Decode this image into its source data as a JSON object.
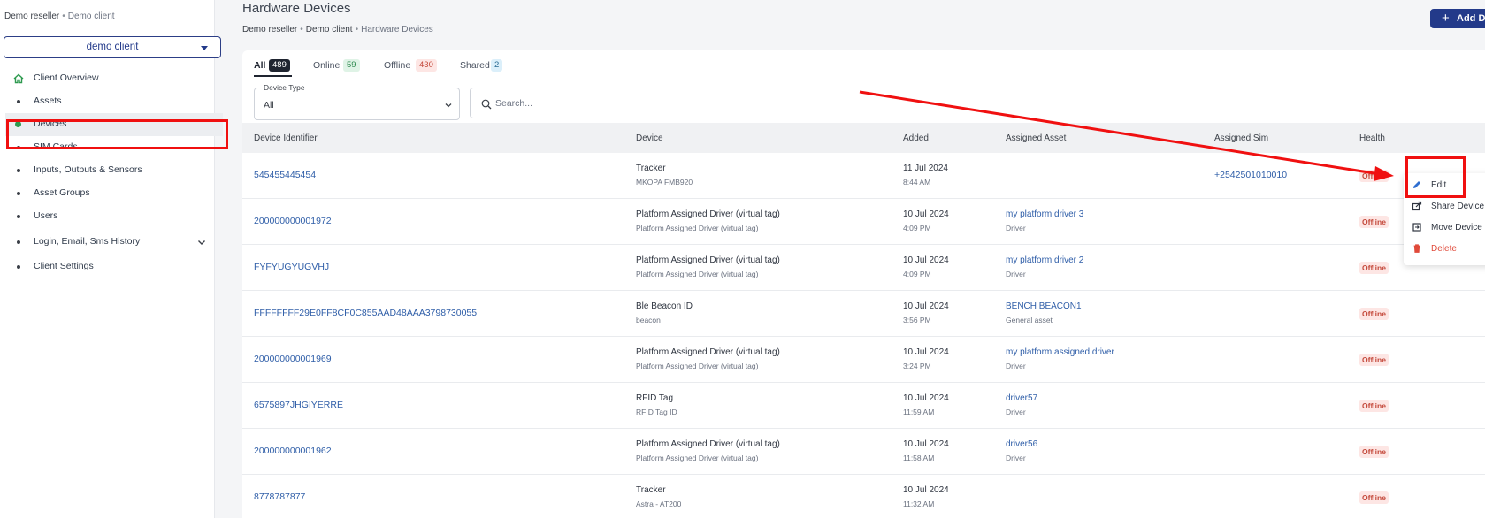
{
  "sidebar": {
    "breadcrumb": {
      "reseller": "Demo reseller",
      "client": "Demo client"
    },
    "client_select": {
      "value": "demo client"
    },
    "items": [
      {
        "label": "Client Overview",
        "icon": "home-icon"
      },
      {
        "label": "Assets"
      },
      {
        "label": "Devices",
        "active": true
      },
      {
        "label": "SIM Cards"
      },
      {
        "label": "Inputs, Outputs & Sensors"
      },
      {
        "label": "Asset Groups"
      },
      {
        "label": "Users"
      },
      {
        "label": "Login, Email, Sms History",
        "icon": "chevron-down-icon"
      },
      {
        "label": "Client Settings"
      }
    ]
  },
  "header": {
    "title": "Hardware Devices",
    "breadcrumb": {
      "reseller": "Demo reseller",
      "client": "Demo client",
      "current": "Hardware Devices"
    },
    "add_button": "Add De"
  },
  "tabs": [
    {
      "label": "All",
      "count": "489"
    },
    {
      "label": "Online",
      "count": "59"
    },
    {
      "label": "Offline",
      "count": "430"
    },
    {
      "label": "Shared",
      "count": "2"
    }
  ],
  "filters": {
    "device_type": {
      "label": "Device Type",
      "value": "All"
    },
    "search": {
      "placeholder": "Search..."
    }
  },
  "table": {
    "columns": [
      "Device Identifier",
      "Device",
      "Added",
      "Assigned Asset",
      "Assigned Sim",
      "Health"
    ],
    "rows": [
      {
        "id": "545455445454",
        "device": "Tracker",
        "device_sub": "MKOPA FMB920",
        "date": "11 Jul 2024",
        "time": "8:44 AM",
        "asset": "",
        "asset_sub": "",
        "sim": "+2542501010010",
        "health": "Offline"
      },
      {
        "id": "200000000001972",
        "device": "Platform Assigned Driver (virtual tag)",
        "device_sub": "Platform Assigned Driver (virtual tag)",
        "date": "10 Jul 2024",
        "time": "4:09 PM",
        "asset": "my platform driver 3",
        "asset_sub": "Driver",
        "sim": "",
        "health": "Offline"
      },
      {
        "id": "FYFYUGYUGVHJ",
        "device": "Platform Assigned Driver (virtual tag)",
        "device_sub": "Platform Assigned Driver (virtual tag)",
        "date": "10 Jul 2024",
        "time": "4:09 PM",
        "asset": "my platform driver 2",
        "asset_sub": "Driver",
        "sim": "",
        "health": "Offline"
      },
      {
        "id": "FFFFFFFF29E0FF8CF0C855AAD48AAA3798730055",
        "device": "Ble Beacon ID",
        "device_sub": "beacon",
        "date": "10 Jul 2024",
        "time": "3:56 PM",
        "asset": "BENCH BEACON1",
        "asset_sub": "General asset",
        "sim": "",
        "health": "Offline"
      },
      {
        "id": "200000000001969",
        "device": "Platform Assigned Driver (virtual tag)",
        "device_sub": "Platform Assigned Driver (virtual tag)",
        "date": "10 Jul 2024",
        "time": "3:24 PM",
        "asset": "my platform assigned driver",
        "asset_sub": "Driver",
        "sim": "",
        "health": "Offline"
      },
      {
        "id": "6575897JHGIYERRE",
        "device": "RFID Tag",
        "device_sub": "RFID Tag ID",
        "date": "10 Jul 2024",
        "time": "11:59 AM",
        "asset": "driver57",
        "asset_sub": "Driver",
        "sim": "",
        "health": "Offline"
      },
      {
        "id": "200000000001962",
        "device": "Platform Assigned Driver (virtual tag)",
        "device_sub": "Platform Assigned Driver (virtual tag)",
        "date": "10 Jul 2024",
        "time": "11:58 AM",
        "asset": "driver56",
        "asset_sub": "Driver",
        "sim": "",
        "health": "Offline"
      },
      {
        "id": "8778787877",
        "device": "Tracker",
        "device_sub": "Astra - AT200",
        "date": "10 Jul 2024",
        "time": "11:32 AM",
        "asset": "",
        "asset_sub": "",
        "sim": "",
        "health": "Offline"
      }
    ]
  },
  "context_menu": {
    "items": [
      {
        "label": "Edit",
        "icon": "pencil-icon"
      },
      {
        "label": "Share Device",
        "icon": "share-icon"
      },
      {
        "label": "Move Device",
        "icon": "move-icon"
      },
      {
        "label": "Delete",
        "icon": "trash-icon"
      }
    ]
  },
  "colors": {
    "primary": "#233a8a",
    "link": "#2f5ea8",
    "active_dot": "#2e9a4f",
    "offline": "#c44a3c",
    "annotation": "#f01010"
  }
}
